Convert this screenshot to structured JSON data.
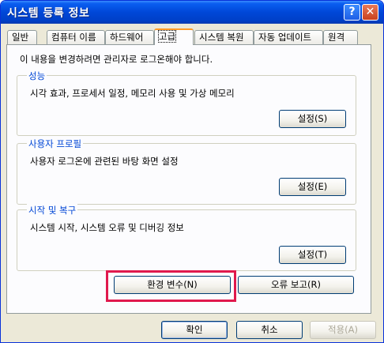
{
  "window": {
    "title": "시스템 등록 정보",
    "help_glyph": "?",
    "close_glyph": "✕"
  },
  "tabs": [
    "일반",
    "컴퓨터 이름",
    "하드웨어",
    "고급",
    "시스템 복원",
    "자동 업데이트",
    "원격"
  ],
  "active_tab": "고급",
  "admin_note": "이 내용을 변경하려면 관리자로 로그온해야 합니다.",
  "groups": {
    "performance": {
      "label": "성능",
      "description": "시각 효과, 프로세서 일정, 메모리 사용 및 가상 메모리",
      "button": "설정(S)"
    },
    "profiles": {
      "label": "사용자 프로필",
      "description": "사용자 로그온에 관련된 바탕 화면 설정",
      "button": "설정(E)"
    },
    "startup": {
      "label": "시작 및 복구",
      "description": "시스템 시작, 시스템 오류 및 디버깅 정보",
      "button": "설정(T)"
    }
  },
  "env_button": "환경 변수(N)",
  "error_button": "오류 보고(R)",
  "footer": {
    "ok": "확인",
    "cancel": "취소",
    "apply": "적용(A)"
  },
  "colors": {
    "titlebar": "#0047d8",
    "highlight": "#e0194d",
    "group_label": "#0046d5"
  }
}
